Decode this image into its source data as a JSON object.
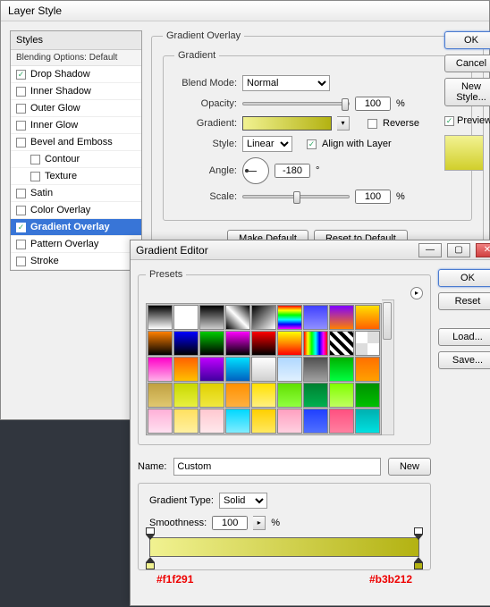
{
  "layerStyle": {
    "title": "Layer Style",
    "stylesHeader": "Styles",
    "blendingDefault": "Blending Options: Default",
    "items": [
      {
        "label": "Drop Shadow",
        "checked": true,
        "selected": false,
        "indent": false
      },
      {
        "label": "Inner Shadow",
        "checked": false,
        "selected": false,
        "indent": false
      },
      {
        "label": "Outer Glow",
        "checked": false,
        "selected": false,
        "indent": false
      },
      {
        "label": "Inner Glow",
        "checked": false,
        "selected": false,
        "indent": false
      },
      {
        "label": "Bevel and Emboss",
        "checked": false,
        "selected": false,
        "indent": false
      },
      {
        "label": "Contour",
        "checked": false,
        "selected": false,
        "indent": true
      },
      {
        "label": "Texture",
        "checked": false,
        "selected": false,
        "indent": true
      },
      {
        "label": "Satin",
        "checked": false,
        "selected": false,
        "indent": false
      },
      {
        "label": "Color Overlay",
        "checked": false,
        "selected": false,
        "indent": false
      },
      {
        "label": "Gradient Overlay",
        "checked": true,
        "selected": true,
        "indent": false
      },
      {
        "label": "Pattern Overlay",
        "checked": false,
        "selected": false,
        "indent": false
      },
      {
        "label": "Stroke",
        "checked": false,
        "selected": false,
        "indent": false
      }
    ],
    "overlay": {
      "legend": "Gradient Overlay",
      "innerLegend": "Gradient",
      "blendLabel": "Blend Mode:",
      "blendValue": "Normal",
      "opacityLabel": "Opacity:",
      "opacityValue": "100",
      "opacityPct": "%",
      "gradientLabel": "Gradient:",
      "reverseLabel": "Reverse",
      "styleLabel": "Style:",
      "styleValue": "Linear",
      "alignLabel": "Align with Layer",
      "angleLabel": "Angle:",
      "angleValue": "-180",
      "angleDeg": "°",
      "scaleLabel": "Scale:",
      "scaleValue": "100",
      "scalePct": "%",
      "makeDefault": "Make Default",
      "resetDefault": "Reset to Default"
    },
    "buttons": {
      "ok": "OK",
      "cancel": "Cancel",
      "newStyle": "New Style...",
      "preview": "Preview"
    }
  },
  "gradEditor": {
    "title": "Gradient Editor",
    "presetsLegend": "Presets",
    "swatches": [
      "linear-gradient(#000,#fff)",
      "linear-gradient(#fff,#fff)",
      "linear-gradient(#000,transparent)",
      "linear-gradient(45deg,#000,#fff,#000)",
      "linear-gradient(135deg,#000,#fff)",
      "linear-gradient(#f00,#ff0,#0f0,#0ff,#00f,#f0f)",
      "linear-gradient(#4040ff,#9090ff)",
      "linear-gradient(#8000ff,#ff8000)",
      "linear-gradient(#ffe000,#ff6000)",
      "linear-gradient(#ff8000,#000)",
      "linear-gradient(#00f,#000)",
      "linear-gradient(#0c0,#000)",
      "linear-gradient(#f0f,#000)",
      "linear-gradient(#f00,#000)",
      "linear-gradient(#ff0,#f80,#f00)",
      "linear-gradient(90deg,#f00,#ff0,#0f0,#0ff,#00f,#f0f,#f00)",
      "repeating-linear-gradient(45deg,#000 0 4px,#fff 4px 8px)",
      "repeating-conic-gradient(#ddd 0 25%,#fff 0 50%)",
      "linear-gradient(#ff00c8,#ffb0e8)",
      "linear-gradient(#ff6000,#ffc000)",
      "linear-gradient(#c000ff,#4000a0)",
      "linear-gradient(#00e0ff,#0060c0)",
      "linear-gradient(#ffffff,#d0d0d0)",
      "linear-gradient(#b0d8ff,#e0f0ff)",
      "linear-gradient(#505050,#a0a0a0)",
      "linear-gradient(#00b000,#00ff40)",
      "linear-gradient(#ff7000,#ffa000)",
      "linear-gradient(#c0a040,#e0c870)",
      "linear-gradient(#c8d800,#e8f040)",
      "linear-gradient(#e0d000,#f0e840)",
      "linear-gradient(#ff9000,#ffb040)",
      "linear-gradient(#ffe000,#fff080)",
      "linear-gradient(#60e000,#90ff40)",
      "linear-gradient(#008030,#00b050)",
      "linear-gradient(#80ff00,#c0ff60)",
      "linear-gradient(#009000,#00c000)",
      "linear-gradient(#ffb0d8,#ffe0f0)",
      "linear-gradient(#ffe060,#fff0a0)",
      "linear-gradient(#ffc8d0,#ffe8ec)",
      "linear-gradient(#00d8ff,#80ecff)",
      "linear-gradient(#ffd000,#ffe860)",
      "linear-gradient(#ffa0c0,#ffd0e0)",
      "linear-gradient(#2040ff,#5070ff)",
      "linear-gradient(#ff5080,#ff80a0)",
      "linear-gradient(#00b0b0,#00e0e0)"
    ],
    "nameLabel": "Name:",
    "nameValue": "Custom",
    "newBtn": "New",
    "typeLegend": "Gradient Type:",
    "typeValue": "Solid",
    "smoothLabel": "Smoothness:",
    "smoothValue": "100",
    "smoothPct": "%",
    "hexLeft": "#f1f291",
    "hexRight": "#b3b212",
    "buttons": {
      "ok": "OK",
      "reset": "Reset",
      "load": "Load...",
      "save": "Save..."
    }
  }
}
